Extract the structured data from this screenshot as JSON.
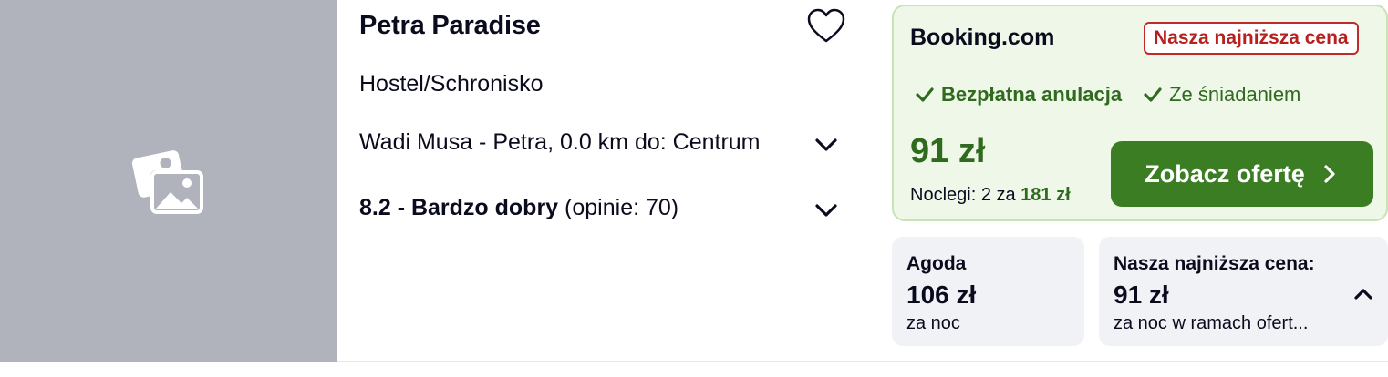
{
  "hotel": {
    "name": "Petra Paradise",
    "type": "Hostel/Schronisko",
    "location": "Wadi Musa - Petra, 0.0 km do: Centrum",
    "rating_label": "8.2 - Bardzo dobry",
    "rating_reviews": "(opinie: 70)",
    "image_placeholder_icon": "images-placeholder-icon",
    "favorite_icon": "heart-outline-icon"
  },
  "best_offer": {
    "provider": "Booking.com",
    "badge": "Nasza najniższa cena",
    "perks": [
      "Bezpłatna anulacja",
      "Ze śniadaniem"
    ],
    "price": "91 zł",
    "nights_label": "Noclegi: 2 za",
    "nights_total": "181 zł",
    "cta_label": "Zobacz ofertę",
    "colors": {
      "accent_green": "#3a7d23",
      "badge_red": "#c02a2a",
      "panel_bg": "#eef7e8"
    }
  },
  "alternatives": [
    {
      "provider": "Agoda",
      "price": "106 zł",
      "note": "za noc"
    },
    {
      "provider": "Nasza najniższa cena:",
      "price": "91 zł",
      "note": "za noc w ramach ofert..."
    }
  ]
}
